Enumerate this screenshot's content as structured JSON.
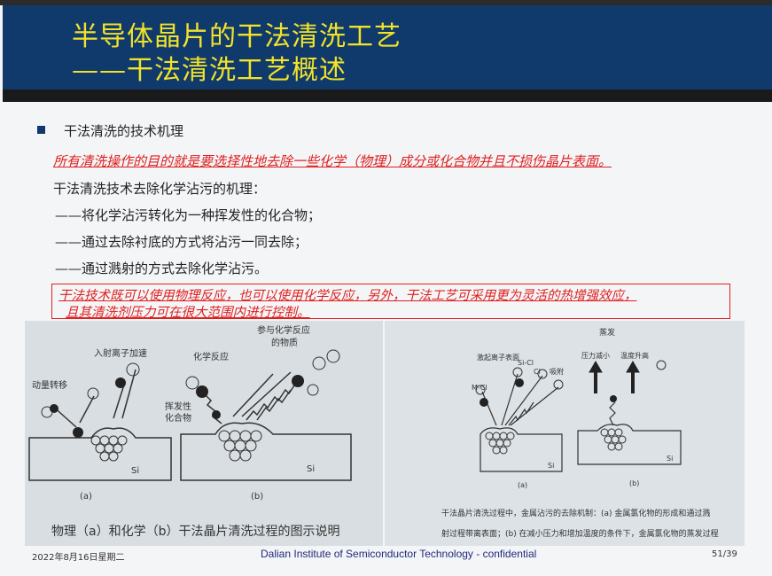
{
  "header": {
    "title_line1": "半导体晶片的干法清洗工艺",
    "title_line2": "——干法清洗工艺概述"
  },
  "content": {
    "bullet": "干法清洗的技术机理",
    "red_line1": "所有清洗操作的目的就是要选择性地去除一些化学（物理）成分或化合物并且不损伤晶片表面。",
    "mechanism_intro": "干法清洗技术去除化学沾污的机理：",
    "items": [
      "——将化学沾污转化为一种挥发性的化合物；",
      "——通过去除衬底的方式将沾污一同去除；",
      "——通过溅射的方式去除化学沾污。"
    ],
    "red_note_line1": "干法技术既可以使用物理反应，也可以使用化学反应，另外，干法工艺可采用更为灵活的热增强效应，",
    "red_note_line2": "且其清洗剂压力可在很大范围内进行控制。"
  },
  "figure_left": {
    "label_ion": "入射离子加速",
    "label_momentum": "动量转移",
    "label_participate": "参与化学反应",
    "label_substance": "的物质",
    "label_chem": "化学反应",
    "label_volatile1": "挥发性",
    "label_volatile2": "化合物",
    "label_si_a": "Si",
    "label_si_b": "Si",
    "label_a": "(a)",
    "label_b": "(b)",
    "caption": "物理（a）和化学（b）干法晶片清洗过程的图示说明"
  },
  "figure_right": {
    "label_evap": "蒸发",
    "label_ions": "激起离子表面",
    "label_sicl": "Si-Cl",
    "label_cl": "Cl",
    "label_mcl": "M-Cl",
    "label_attach": "吸附",
    "label_pressure": "压力减小",
    "label_temp": "温度升高",
    "label_si_a": "Si",
    "label_si_b": "Si",
    "label_a": "(a)",
    "label_b": "(b)",
    "caption_line1": "干法晶片清洗过程中，金属沾污的去除机制：(a) 金属氯化物的形成和通过溅",
    "caption_line2": "射过程带离表面；(b) 在减小压力和增加温度的条件下，金属氯化物的蒸发过程"
  },
  "footer": {
    "date": "2022年8月16日星期二",
    "center": "Dalian Institute of Semiconductor Technology - confidential",
    "page": "51/39"
  },
  "colors": {
    "header_bg": "#0f3a6b",
    "title": "#f2e22a",
    "red": "#e01f1f"
  }
}
